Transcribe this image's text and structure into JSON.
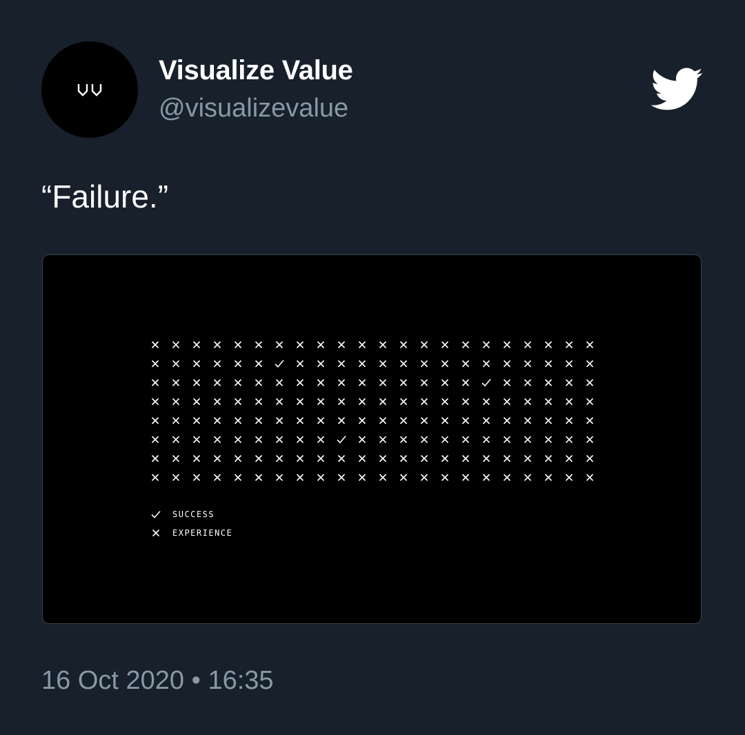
{
  "author": {
    "display_name": "Visualize Value",
    "handle": "@visualizevalue",
    "avatar_icon": "vv-logo-icon"
  },
  "brand_icon": "twitter-bird-icon",
  "tweet": {
    "text": "“Failure.”",
    "timestamp": "16 Oct 2020 • 16:35"
  },
  "media": {
    "grid": {
      "columns": 22,
      "rows": 8,
      "default_mark": "x",
      "checks": [
        {
          "row": 1,
          "col": 6
        },
        {
          "row": 2,
          "col": 16
        },
        {
          "row": 5,
          "col": 9
        }
      ]
    },
    "legend": [
      {
        "mark": "check",
        "label": "SUCCESS"
      },
      {
        "mark": "x",
        "label": "EXPERIENCE"
      }
    ]
  },
  "colors": {
    "background": "#17202b",
    "secondary_text": "#8899a6",
    "media_background": "#000000",
    "mark": "#ffffff"
  }
}
